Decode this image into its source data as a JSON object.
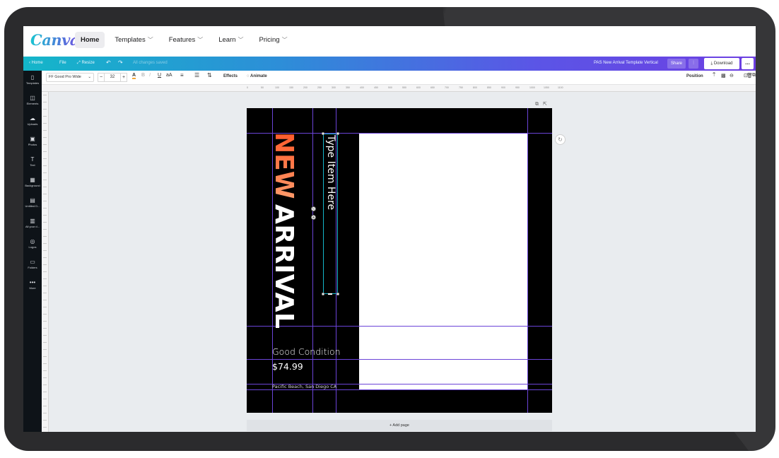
{
  "site": {
    "logo": "Canva",
    "nav": [
      {
        "label": "Home",
        "active": true,
        "chevron": false
      },
      {
        "label": "Templates",
        "active": false,
        "chevron": true
      },
      {
        "label": "Features",
        "active": false,
        "chevron": true
      },
      {
        "label": "Learn",
        "active": false,
        "chevron": true
      },
      {
        "label": "Pricing",
        "active": false,
        "chevron": true
      }
    ]
  },
  "editor_bar": {
    "home": "‹  Home",
    "file": "File",
    "resize": "⤢ Resize",
    "unsaved": "All changes saved",
    "doc_title": "PAS New Arrival Template Vertical",
    "share": "Share",
    "download": "Download",
    "more": "..."
  },
  "format_bar": {
    "font": "FF Good Pro Wide",
    "size": "32",
    "minus": "−",
    "plus": "+",
    "effects": "Effects",
    "animate": "Animate",
    "position": "Position"
  },
  "sidebar": [
    {
      "icon": "templates-icon",
      "glyph": "▯",
      "label": "Templates"
    },
    {
      "icon": "elements-icon",
      "glyph": "◫",
      "label": "Elements"
    },
    {
      "icon": "uploads-icon",
      "glyph": "☁",
      "label": "Uploads"
    },
    {
      "icon": "photos-icon",
      "glyph": "▣",
      "label": "Photos"
    },
    {
      "icon": "text-icon",
      "glyph": "T",
      "label": "Text"
    },
    {
      "icon": "background-icon",
      "glyph": "▦",
      "label": "Background"
    },
    {
      "icon": "untitled-icon",
      "glyph": "▤",
      "label": "Untitled D..."
    },
    {
      "icon": "all-your-designs-icon",
      "glyph": "▥",
      "label": "All your d..."
    },
    {
      "icon": "logos-icon",
      "glyph": "◎",
      "label": "Logos"
    },
    {
      "icon": "folders-icon",
      "glyph": "▭",
      "label": "Folders"
    },
    {
      "icon": "more-icon",
      "glyph": "•••",
      "label": "More"
    }
  ],
  "ruler_ticks": [
    "0",
    "50",
    "100",
    "150",
    "200",
    "250",
    "300",
    "350",
    "400",
    "450",
    "500",
    "550",
    "600",
    "650",
    "700",
    "750",
    "800",
    "850",
    "900",
    "950",
    "1000",
    "1050",
    "1100"
  ],
  "design": {
    "headline_new": "NEW",
    "headline_arrival": "ARRIVAL",
    "item_text": "Type Item Here",
    "condition": "Good Condition",
    "price": "$74.99",
    "location": "Pacific Beach, San Diego CA",
    "colors": {
      "accent": "#ff5a2a",
      "guide": "#6b44d8",
      "selection": "#14b6c9"
    }
  },
  "add_page": "+ Add page"
}
